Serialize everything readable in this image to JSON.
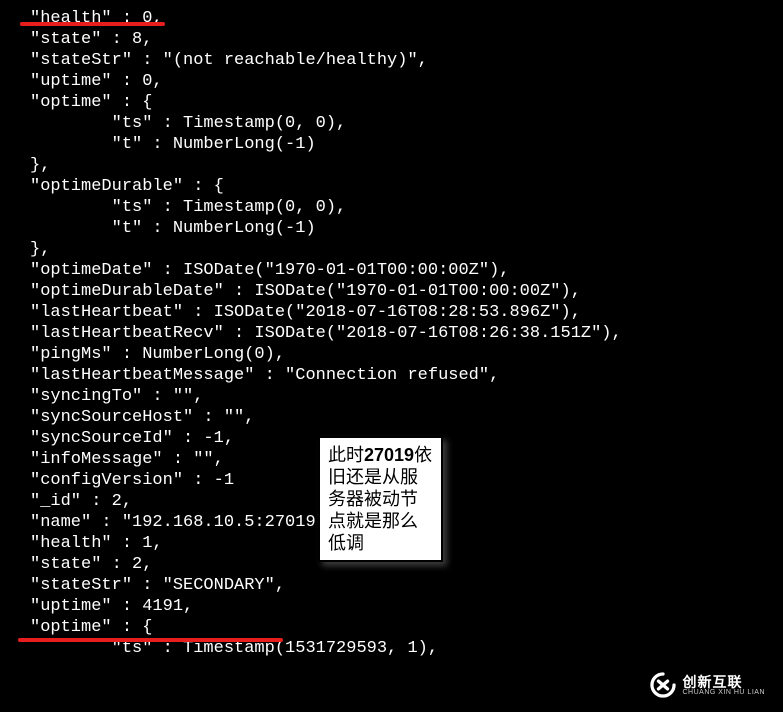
{
  "code": {
    "l1": "\"health\" : 0,",
    "l2": "\"state\" : 8,",
    "l3": "\"stateStr\" : \"(not reachable/healthy)\",",
    "l4": "\"uptime\" : 0,",
    "l5": "\"optime\" : {",
    "l6": "        \"ts\" : Timestamp(0, 0),",
    "l7": "        \"t\" : NumberLong(-1)",
    "l8": "},",
    "l9": "\"optimeDurable\" : {",
    "l10": "        \"ts\" : Timestamp(0, 0),",
    "l11": "        \"t\" : NumberLong(-1)",
    "l12": "},",
    "l13": "\"optimeDate\" : ISODate(\"1970-01-01T00:00:00Z\"),",
    "l14": "\"optimeDurableDate\" : ISODate(\"1970-01-01T00:00:00Z\"),",
    "l15": "\"lastHeartbeat\" : ISODate(\"2018-07-16T08:28:53.896Z\"),",
    "l16": "\"lastHeartbeatRecv\" : ISODate(\"2018-07-16T08:26:38.151Z\"),",
    "l17": "\"pingMs\" : NumberLong(0),",
    "l18": "\"lastHeartbeatMessage\" : \"Connection refused\",",
    "l19": "\"syncingTo\" : \"\",",
    "l20": "\"syncSourceHost\" : \"\",",
    "l21": "\"syncSourceId\" : -1,",
    "l22": "\"infoMessage\" : \"\",",
    "l23": "\"configVersion\" : -1",
    "l24": "",
    "l25": "",
    "l26": "\"_id\" : 2,",
    "l27": "\"name\" : \"192.168.10.5:27019\",",
    "l28": "\"health\" : 1,",
    "l29": "\"state\" : 2,",
    "l30": "\"stateStr\" : \"SECONDARY\",",
    "l31": "\"uptime\" : 4191,",
    "l32": "\"optime\" : {",
    "l33": "        \"ts\" : Timestamp(1531729593, 1),"
  },
  "annotation": {
    "port": "27019",
    "prefix": "此时",
    "suffix": "依旧还是从服务器被动节点就是那么低调"
  },
  "logo": {
    "cn": "创新互联",
    "en": "CHUANG XIN HU LIAN"
  }
}
